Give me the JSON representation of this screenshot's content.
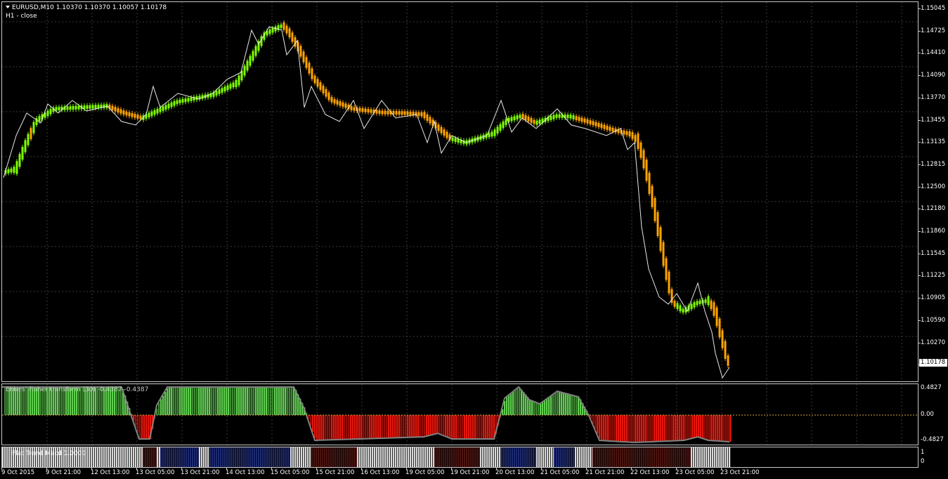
{
  "main": {
    "title": "EURUSD,M10  1.10370 1.10370 1.10057 1.10178",
    "indicator_label": "H1 - close",
    "current_price": "1.10178",
    "price_ticks": [
      "1.15045",
      "1.14725",
      "1.14410",
      "1.14090",
      "1.13770",
      "1.13455",
      "1.13135",
      "1.12815",
      "1.12500",
      "1.12180",
      "1.11860",
      "1.11545",
      "1.11225",
      "1.10905",
      "1.10590",
      "1.10270",
      "1.09950"
    ]
  },
  "fisher": {
    "label": "Ehlers' Fisher transform (30) -0.4387 -0.4387",
    "ticks": [
      "0.4827",
      "0.00",
      "-0.4827"
    ]
  },
  "flat": {
    "label": "Flat Trend Macd 1.0000",
    "ticks": [
      "1",
      "0"
    ]
  },
  "time_axis": [
    "9 Oct 2015",
    "9 Oct 21:00",
    "12 Oct 13:00",
    "13 Oct 05:00",
    "13 Oct 21:00",
    "14 Oct 13:00",
    "15 Oct 05:00",
    "15 Oct 21:00",
    "16 Oct 13:00",
    "19 Oct 05:00",
    "19 Oct 21:00",
    "20 Oct 13:00",
    "21 Oct 05:00",
    "21 Oct 21:00",
    "22 Oct 13:00",
    "23 Oct 05:00",
    "23 Oct 21:00"
  ],
  "colors": {
    "up": "#7fff00",
    "down": "#ffa500",
    "hist_up": "#5fcf4f",
    "hist_down": "#e8160c",
    "gray": "#808080",
    "navy": "#1e2a6e",
    "maroon": "#4a1410",
    "light": "#d8d8d8"
  }
}
